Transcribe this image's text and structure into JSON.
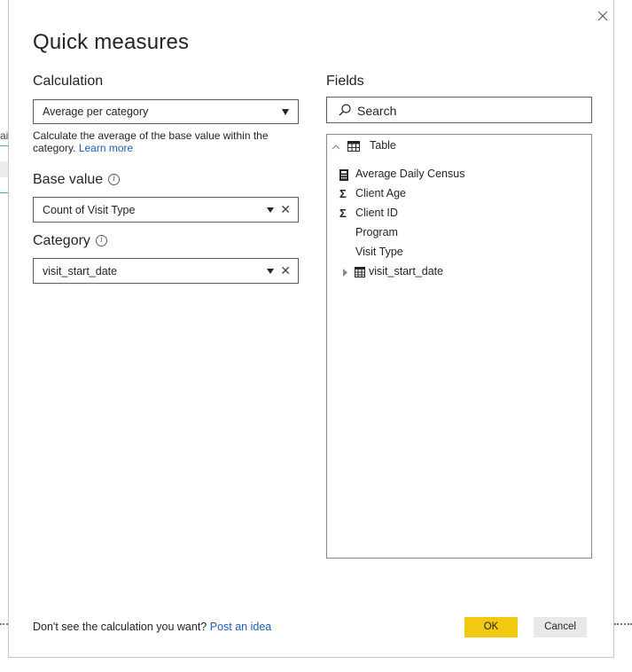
{
  "background": {
    "fragment_text": "ai"
  },
  "dialog": {
    "title": "Quick measures",
    "close_icon": "close-icon"
  },
  "calculation": {
    "label": "Calculation",
    "selected": "Average per category",
    "description": "Calculate the average of the base value within the category.",
    "learn_more": "Learn more"
  },
  "base_value": {
    "label": "Base value",
    "info_icon": "info-icon",
    "value": "Count of Visit Type"
  },
  "category": {
    "label": "Category",
    "info_icon": "info-icon",
    "value": "visit_start_date"
  },
  "fields": {
    "label": "Fields",
    "search_placeholder": "Search",
    "table": {
      "name": "Table",
      "items": [
        {
          "name": "Average Daily Census",
          "icon": "calculator-icon"
        },
        {
          "name": "Client Age",
          "icon": "sigma-icon"
        },
        {
          "name": "Client ID",
          "icon": "sigma-icon"
        },
        {
          "name": "Program",
          "icon": ""
        },
        {
          "name": "Visit Type",
          "icon": ""
        },
        {
          "name": "visit_start_date",
          "icon": "calendar-table-icon",
          "expandable": true
        }
      ]
    }
  },
  "footer": {
    "prompt": "Don't see the calculation you want?",
    "link": "Post an idea",
    "ok_label": "OK",
    "cancel_label": "Cancel"
  },
  "colors": {
    "ok_button": "#f2c811",
    "link": "#1a5fb4",
    "accent_teal": "#3bb8a8"
  }
}
